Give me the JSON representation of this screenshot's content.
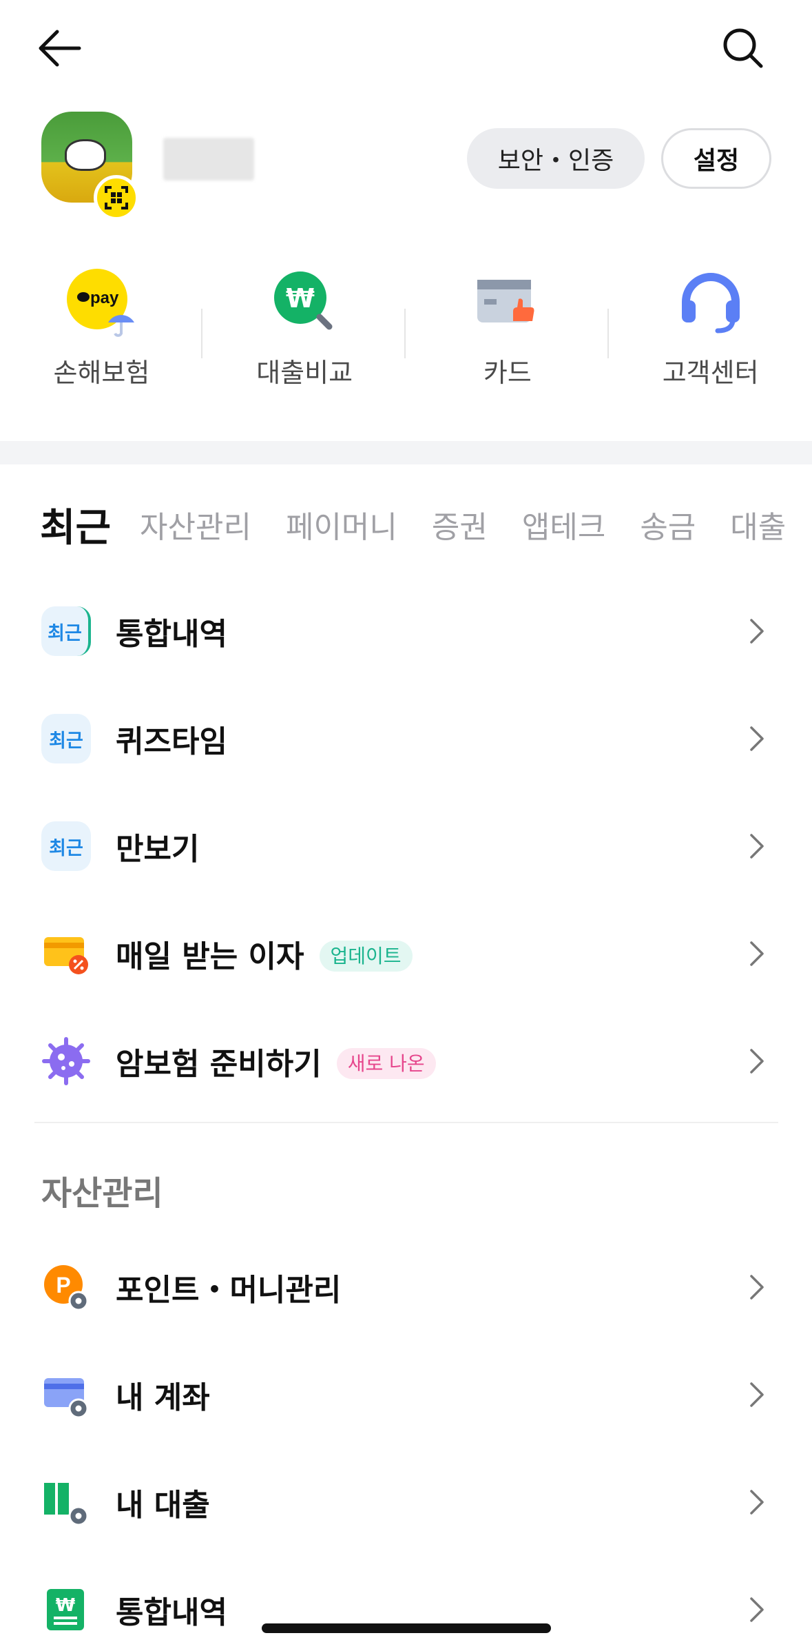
{
  "header": {
    "back_icon": "arrow-left-icon",
    "search_icon": "search-icon"
  },
  "profile": {
    "security_label": "보안・인증",
    "settings_label": "설정"
  },
  "shortcuts": [
    {
      "label": "손해보험",
      "icon": "pay-insurance-icon"
    },
    {
      "label": "대출비교",
      "icon": "loan-compare-icon"
    },
    {
      "label": "카드",
      "icon": "card-icon"
    },
    {
      "label": "고객센터",
      "icon": "headset-icon"
    }
  ],
  "tabs": [
    "최근",
    "자산관리",
    "페이머니",
    "증권",
    "앱테크",
    "송금",
    "대출"
  ],
  "recent": {
    "badge_text": "최근",
    "items": [
      {
        "label": "통합내역",
        "icon": "recent-badge-icon"
      },
      {
        "label": "퀴즈타임",
        "icon": "recent-badge-icon"
      },
      {
        "label": "만보기",
        "icon": "recent-badge-icon"
      },
      {
        "label": "매일 받는 이자",
        "icon": "interest-card-icon",
        "badge": "업데이트"
      },
      {
        "label": "암보험 준비하기",
        "icon": "virus-icon",
        "badge": "새로 나온"
      }
    ]
  },
  "asset_section": {
    "title": "자산관리",
    "items": [
      {
        "label": "포인트・머니관리",
        "icon": "point-gear-icon"
      },
      {
        "label": "내 계좌",
        "icon": "account-gear-icon"
      },
      {
        "label": "내 대출",
        "icon": "loan-gear-icon"
      },
      {
        "label": "통합내역",
        "icon": "won-ledger-icon"
      }
    ]
  },
  "colors": {
    "kakao_yellow": "#fedd00",
    "update_badge_bg": "#e3f7f2",
    "update_badge_fg": "#1bb48e",
    "new_badge_bg": "#fde8f1",
    "new_badge_fg": "#e6468c"
  }
}
